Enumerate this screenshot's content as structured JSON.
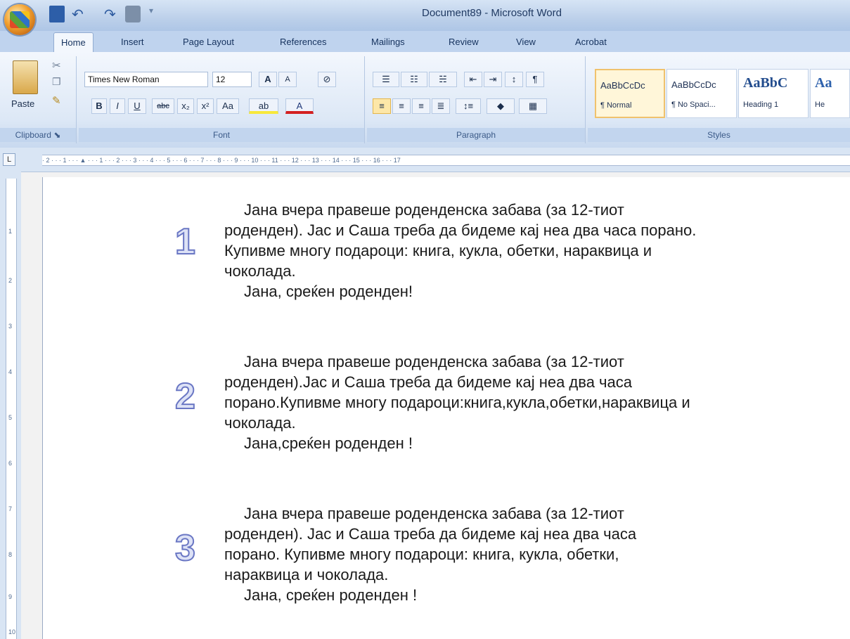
{
  "window": {
    "title": "Document89 - Microsoft Word"
  },
  "tabs": [
    "Home",
    "Insert",
    "Page Layout",
    "References",
    "Mailings",
    "Review",
    "View",
    "Acrobat"
  ],
  "ribbon": {
    "clipboard": {
      "paste_label": "Paste",
      "group_label": "Clipboard"
    },
    "font": {
      "name": "Times New Roman",
      "size": "12",
      "group_label": "Font"
    },
    "paragraph": {
      "group_label": "Paragraph"
    },
    "styles": {
      "group_label": "Styles",
      "items": [
        {
          "sample": "AaBbCcDc",
          "name": "¶ Normal"
        },
        {
          "sample": "AaBbCcDc",
          "name": "¶ No Spaci..."
        },
        {
          "sample": "AaBbC",
          "name": "Heading 1"
        },
        {
          "sample": "Aa",
          "name": "He"
        }
      ]
    }
  },
  "ruler": {
    "text": "· 2 · · · 1 · · · ▲ · · · 1 · · · 2 · · · 3 · · · 4 · · · 5 · · · 6 · · · 7 · · · 8 · · · 9 · · · 10 · · · 11 · · · 12 · · · 13 · · · 14 · · · 15 · · · 16 · · · 17",
    "vertical": [
      "1",
      "2",
      "3",
      "4",
      "5",
      "6",
      "7",
      "8",
      "9",
      "10"
    ]
  },
  "document": {
    "paragraphs": [
      {
        "number": "1",
        "lines": [
          "Јана  вчера правеше роденденска забава (за 12-тиот",
          "роденден). Јас и Саша треба да бидеме кај неа два часа порано.",
          "Купивме многу подароци: книга, кукла, обетки, нараквица и",
          "чоколада."
        ],
        "closing": "Јана, среќен роденден!"
      },
      {
        "number": "2",
        "lines": [
          "Јана  вчера правеше роденденска забава (за 12-тиот",
          "роденден).Јас и Саша треба да бидеме кај неа два часа",
          "порано.Купивме многу подароци:книга,кукла,обетки,нараквица и",
          "чоколада."
        ],
        "closing": "Јана,среќен роденден  !"
      },
      {
        "number": "3",
        "lines": [
          "Јана  вчера правеше роденденска забава (за 12-тиот",
          "роденден). Јас  и  Саша  треба  да  бидеме кај неа два часа",
          "порано.  Купивме  многу  подароци:  книга,  кукла,  обетки,",
          "нараквица  и   чоколада."
        ],
        "closing": "Јана, среќен роденден !"
      }
    ]
  }
}
